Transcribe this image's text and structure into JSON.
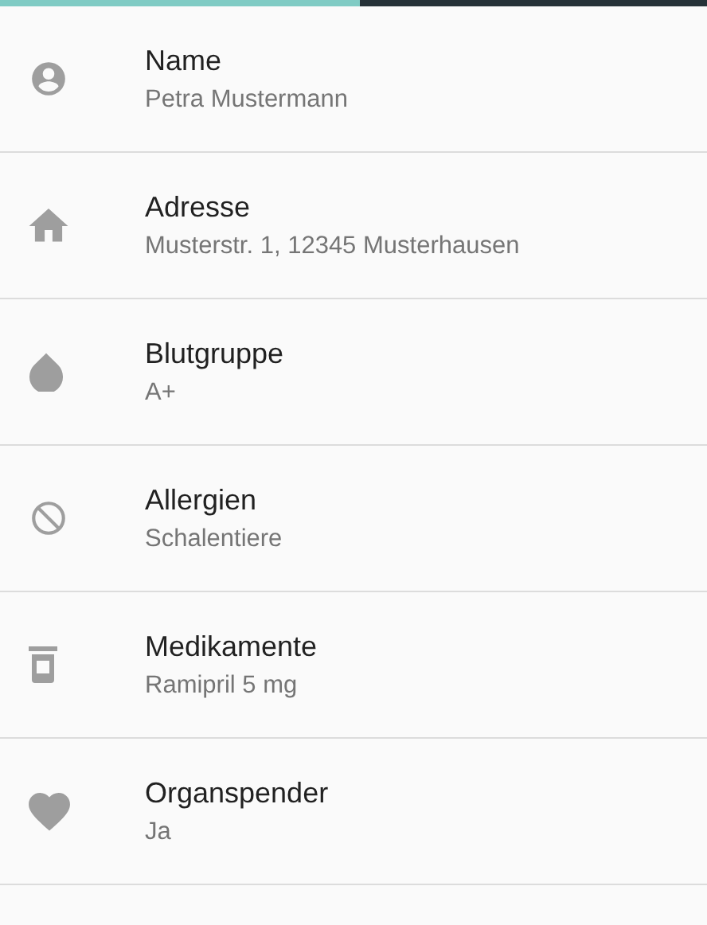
{
  "progress": {
    "level": 0.51
  },
  "items": [
    {
      "kind": "person",
      "title": "Name",
      "value": "Petra Mustermann"
    },
    {
      "kind": "home",
      "title": "Adresse",
      "value": "Musterstr. 1, 12345 Musterhausen"
    },
    {
      "kind": "drop",
      "title": "Blutgruppe",
      "value": "A+"
    },
    {
      "kind": "block",
      "title": "Allergien",
      "value": "Schalentiere"
    },
    {
      "kind": "medication",
      "title": "Medikamente",
      "value": "Ramipril 5 mg"
    },
    {
      "kind": "heart",
      "title": "Organspender",
      "value": "Ja"
    }
  ]
}
